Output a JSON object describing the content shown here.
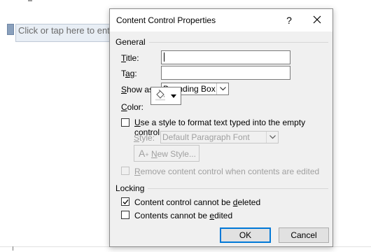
{
  "document": {
    "placeholder_text": "Click or tap here to enter text."
  },
  "dialog": {
    "title": "Content Control Properties",
    "help_glyph": "?",
    "general": {
      "label": "General",
      "title_label_u": "T",
      "title_label_rest": "itle:",
      "title_value": "",
      "tag_label_pre": "T",
      "tag_label_u": "a",
      "tag_label_rest": "g:",
      "tag_value": "",
      "show_as_label_u": "S",
      "show_as_label_rest": "how as:",
      "show_as_value": "Bounding Box",
      "color_label_u": "C",
      "color_label_rest": "olor:",
      "use_style_u": "U",
      "use_style_rest": "se a style to format text typed into the empty control",
      "use_style_checked": false,
      "style_label_u": "S",
      "style_label_rest": "tyle:",
      "style_value": "Default Paragraph Font",
      "new_style_u": "N",
      "new_style_rest": "ew Style...",
      "remove_u": "R",
      "remove_rest": "emove content control when contents are edited",
      "remove_checked": false
    },
    "locking": {
      "label": "Locking",
      "cannot_delete_pre": "Content control cannot be ",
      "cannot_delete_u": "d",
      "cannot_delete_rest": "eleted",
      "cannot_delete_checked": true,
      "cannot_edit_pre": "Contents cannot be ",
      "cannot_edit_u": "e",
      "cannot_edit_rest": "dited",
      "cannot_edit_checked": false
    },
    "buttons": {
      "ok": "OK",
      "cancel": "Cancel"
    }
  },
  "colors": {
    "accent": "#0078d7",
    "dialog_bg": "#f0f0f0",
    "control_box_bg": "#e8eef5"
  },
  "icons": {
    "close": "close-icon",
    "paint_bucket": "paint-bucket-icon",
    "chevron": "chevron-down-icon",
    "checkmark": "checkmark-icon"
  }
}
